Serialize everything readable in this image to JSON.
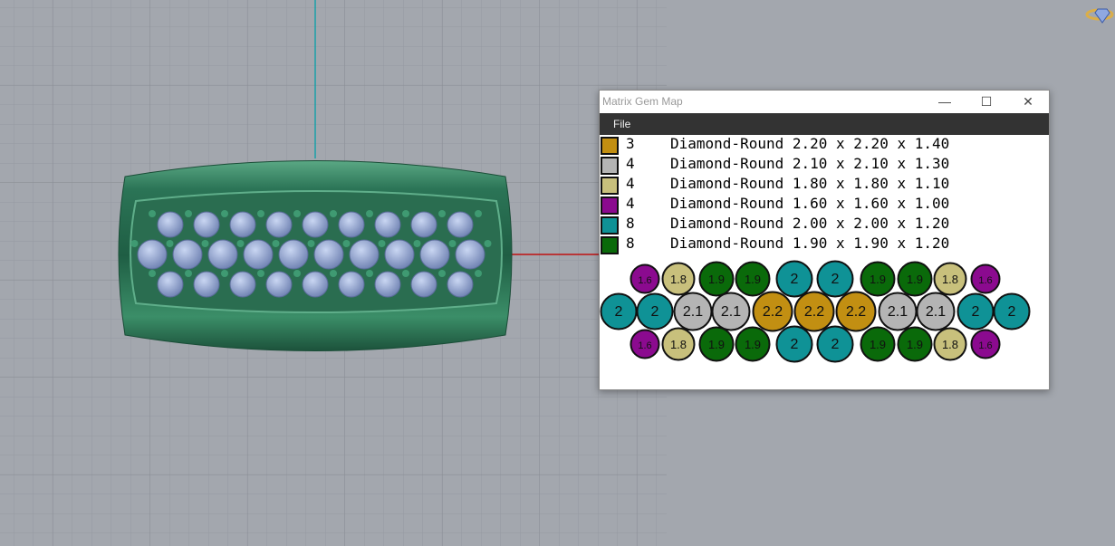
{
  "dialog": {
    "title": "Matrix Gem Map",
    "minimize_icon": "—",
    "maximize_icon": "☐",
    "close_icon": "✕",
    "menu": {
      "file": "File"
    }
  },
  "legend": [
    {
      "color": "#c28f12",
      "count": "3",
      "description": "Diamond-Round 2.20 x 2.20 x 1.40"
    },
    {
      "color": "#b4b4b4",
      "count": "4",
      "description": "Diamond-Round 2.10 x 2.10 x 1.30"
    },
    {
      "color": "#c8c07c",
      "count": "4",
      "description": "Diamond-Round 1.80 x 1.80 x 1.10"
    },
    {
      "color": "#8b0a8f",
      "count": "4",
      "description": "Diamond-Round 1.60 x 1.60 x 1.00"
    },
    {
      "color": "#0f9296",
      "count": "8",
      "description": "Diamond-Round 2.00 x 2.00 x 1.20"
    },
    {
      "color": "#0a6a0a",
      "count": "8",
      "description": "Diamond-Round 1.90 x 1.90 x 1.20"
    }
  ],
  "gem_map": {
    "colors": {
      "1.6": "#8b0a8f",
      "1.8": "#c8c07c",
      "1.9": "#0a6a0a",
      "2": "#0f9296",
      "2.1": "#b4b4b4",
      "2.2": "#c28f12"
    },
    "rows": [
      [
        "1.6",
        "1.8",
        "1.9",
        "1.9",
        "2",
        "2",
        "1.9",
        "1.9",
        "1.8",
        "1.6"
      ],
      [
        "2",
        "2",
        "2.1",
        "2.1",
        "2.2",
        "2.2",
        "2.2",
        "2.1",
        "2.1",
        "2",
        "2"
      ],
      [
        "1.6",
        "1.8",
        "1.9",
        "1.9",
        "2",
        "2",
        "1.9",
        "1.9",
        "1.8",
        "1.6"
      ]
    ]
  },
  "viewport": {
    "ring_color": "#2f7a5a",
    "gem_color": "#9aaedb"
  }
}
